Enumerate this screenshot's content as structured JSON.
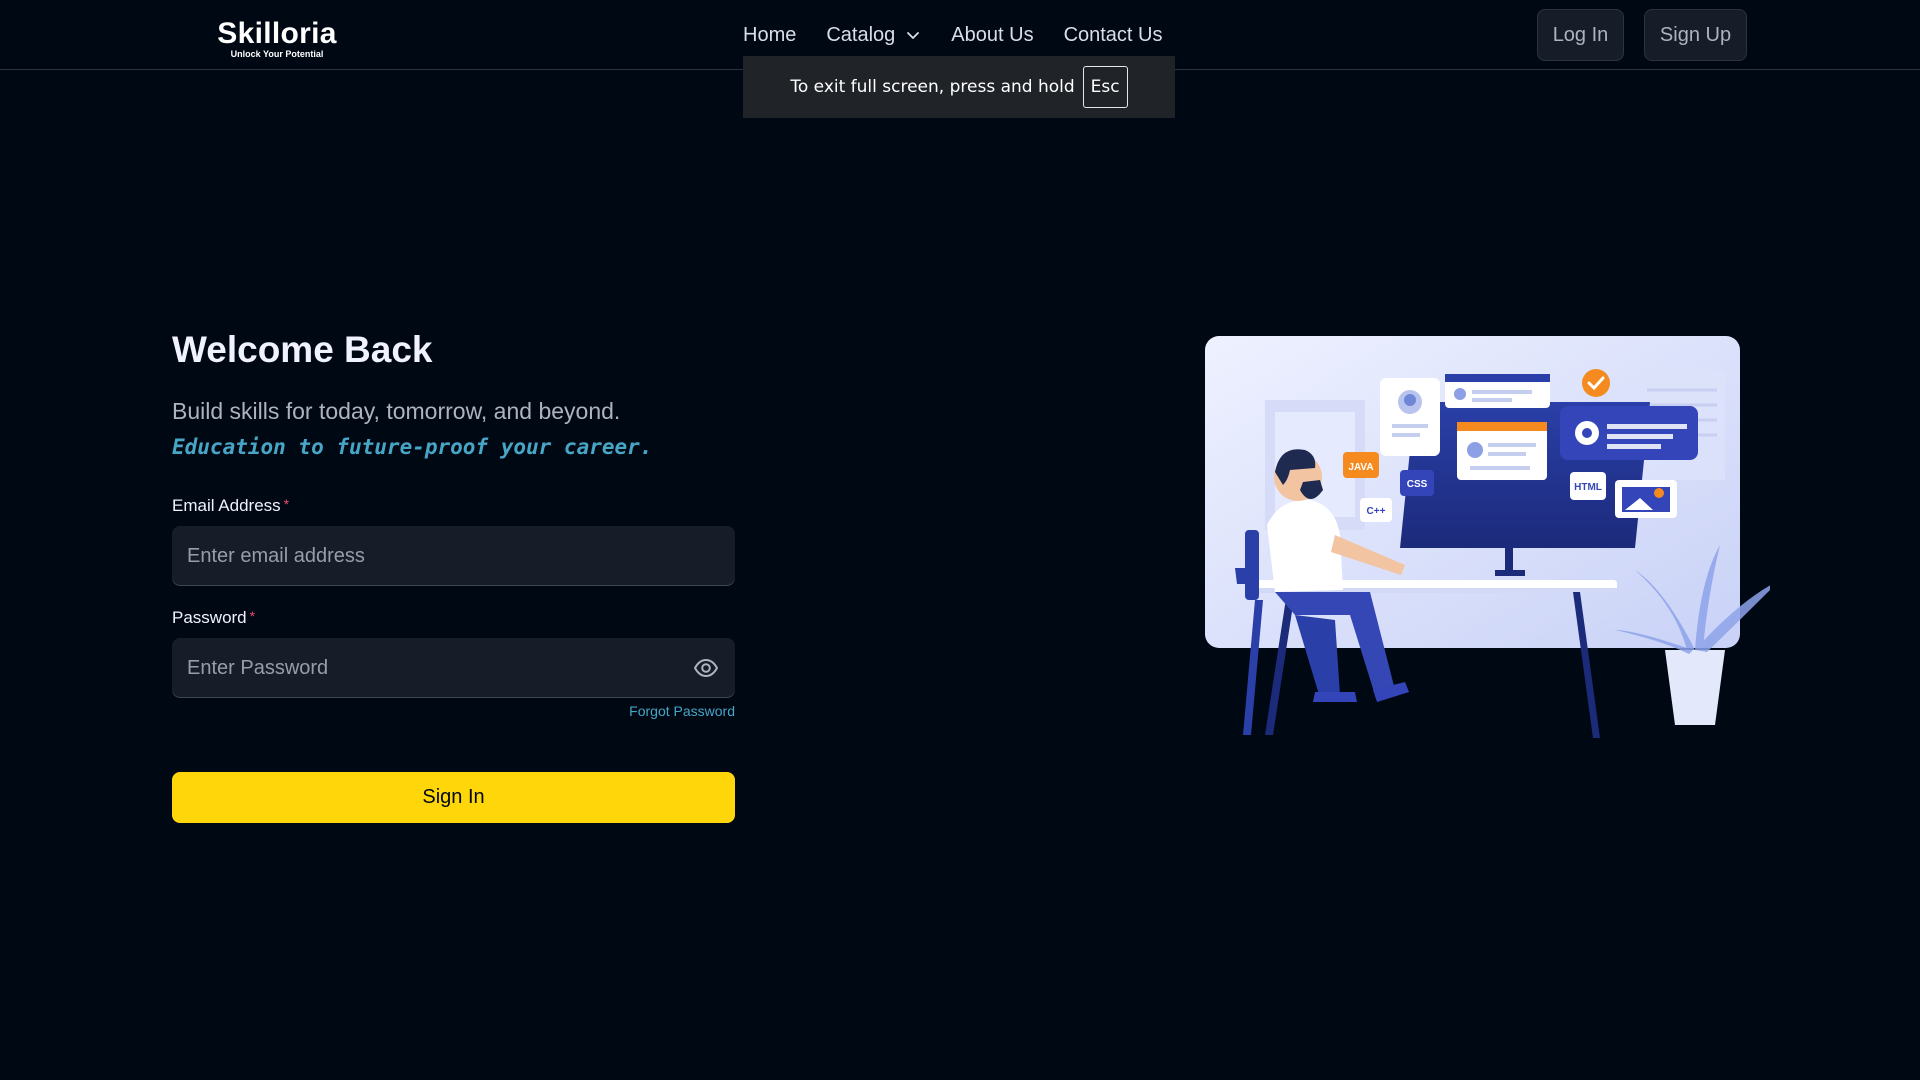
{
  "navbar": {
    "logo_title": "Skilloria",
    "logo_tagline": "Unlock Your Potential",
    "links": [
      {
        "label": "Home"
      },
      {
        "label": "Catalog",
        "icon": "chevron-down-icon"
      },
      {
        "label": "About Us"
      },
      {
        "label": "Contact Us"
      }
    ],
    "login_label": "Log In",
    "signup_label": "Sign Up"
  },
  "fullscreen_toast": {
    "message": "To exit full screen, press and hold",
    "key": "Esc"
  },
  "form": {
    "title": "Welcome Back",
    "subtitle": "Build skills for today, tomorrow, and beyond.",
    "subtitle_accent": "Education to future-proof your career.",
    "email_label": "Email Address",
    "email_placeholder": "Enter email address",
    "password_label": "Password",
    "password_placeholder": "Enter Password",
    "required_mark": "*",
    "forgot_label": "Forgot Password",
    "submit_label": "Sign In"
  },
  "illustration": {
    "tags": [
      "JAVA",
      "CSS",
      "C++",
      "HTML"
    ]
  },
  "colors": {
    "background": "#000814",
    "accent_yellow": "#ffd60a",
    "accent_blue": "#47a5c5",
    "required_red": "#ef476f",
    "input_bg": "#161d29"
  }
}
